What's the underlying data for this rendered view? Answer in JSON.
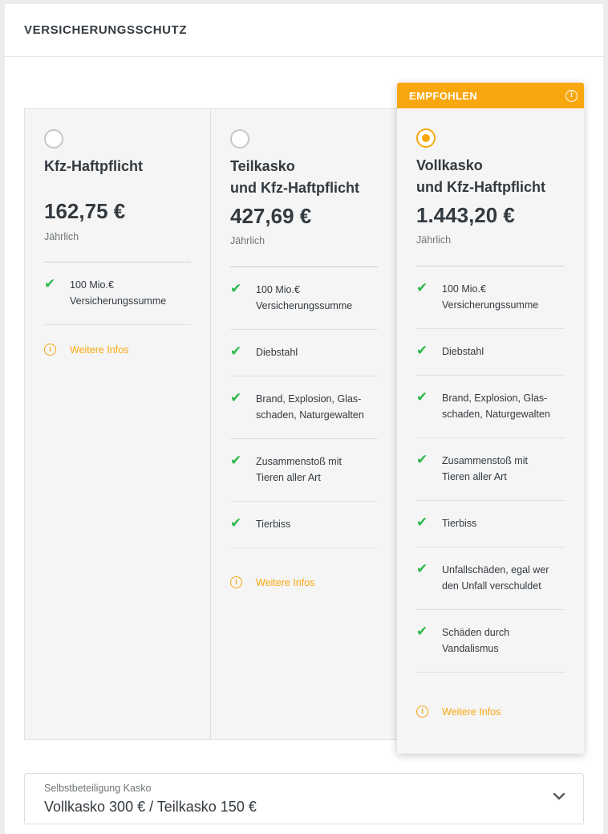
{
  "section": {
    "title": "VERSICHERUNGSSCHUTZ"
  },
  "badge": {
    "label": "EMPFOHLEN",
    "icon": "info-icon"
  },
  "plans": [
    {
      "name_line1": "Kfz-Haftpflicht",
      "name_line2": "",
      "price": "162,75 €",
      "period": "Jährlich",
      "selected": false,
      "features": [
        {
          "line1": "100 Mio.€",
          "line2": "Versicherungssumme"
        }
      ],
      "more_label": "Weitere Infos"
    },
    {
      "name_line1": "Teilkasko",
      "name_line2": "und Kfz-Haftpflicht",
      "price": "427,69 €",
      "period": "Jährlich",
      "selected": false,
      "features": [
        {
          "line1": "100 Mio.€",
          "line2": "Versicherungssumme"
        },
        {
          "line1": "Diebstahl",
          "line2": ""
        },
        {
          "line1": "Brand, Explosion, Glas-",
          "line2": "schaden, Naturgewalten"
        },
        {
          "line1": "Zusammenstoß mit",
          "line2": "Tieren aller Art"
        },
        {
          "line1": "Tierbiss",
          "line2": ""
        }
      ],
      "more_label": "Weitere Infos"
    },
    {
      "name_line1": "Vollkasko",
      "name_line2": "und Kfz-Haftpflicht",
      "price": "1.443,20 €",
      "period": "Jährlich",
      "selected": true,
      "features": [
        {
          "line1": "100 Mio.€",
          "line2": "Versicherungssumme"
        },
        {
          "line1": "Diebstahl",
          "line2": ""
        },
        {
          "line1": "Brand, Explosion, Glas-",
          "line2": "schaden, Naturgewalten"
        },
        {
          "line1": "Zusammenstoß mit",
          "line2": "Tieren aller Art"
        },
        {
          "line1": "Tierbiss",
          "line2": ""
        },
        {
          "line1": "Unfallschäden, egal wer",
          "line2": "den Unfall verschuldet"
        },
        {
          "line1": "Schäden durch",
          "line2": "Vandalismus"
        }
      ],
      "more_label": "Weitere Infos"
    }
  ],
  "deductible": {
    "label": "Selbstbeteiligung Kasko",
    "value": "Vollkasko 300 € / Teilkasko 150 €",
    "icon": "chevron-down-icon"
  },
  "colors": {
    "accent": "#f9a70f",
    "check": "#2db84a",
    "text": "#333a40"
  }
}
